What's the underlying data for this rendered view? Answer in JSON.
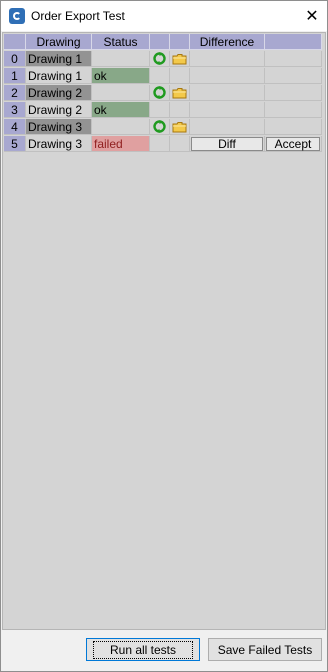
{
  "window": {
    "title": "Order Export Test"
  },
  "grid": {
    "columns": [
      "Drawing",
      "Status",
      "",
      "",
      "Difference",
      ""
    ],
    "rows": [
      {
        "index": "0",
        "drawing": "Drawing 1",
        "drawing_style": "dark",
        "status": "",
        "status_style": "empty",
        "icons": true,
        "buttons": false
      },
      {
        "index": "1",
        "drawing": "Drawing 1",
        "drawing_style": "light",
        "status": "ok",
        "status_style": "ok",
        "icons": false,
        "buttons": false
      },
      {
        "index": "2",
        "drawing": "Drawing 2",
        "drawing_style": "dark",
        "status": "",
        "status_style": "empty",
        "icons": true,
        "buttons": false
      },
      {
        "index": "3",
        "drawing": "Drawing 2",
        "drawing_style": "light",
        "status": "ok",
        "status_style": "ok",
        "icons": false,
        "buttons": false
      },
      {
        "index": "4",
        "drawing": "Drawing 3",
        "drawing_style": "dark",
        "status": "",
        "status_style": "empty",
        "icons": true,
        "buttons": false
      },
      {
        "index": "5",
        "drawing": "Drawing 3",
        "drawing_style": "light",
        "status": "failed",
        "status_style": "failed",
        "icons": false,
        "buttons": true
      }
    ],
    "diff_label": "Diff",
    "accept_label": "Accept",
    "icon_names": [
      "refresh-icon",
      "folder-icon"
    ]
  },
  "footer": {
    "run_all_label": "Run all tests",
    "save_failed_label": "Save Failed Tests"
  },
  "colors": {
    "header": "#a8a8d0",
    "ok": "#88a888",
    "failed": "#e0a0a0",
    "drawing_dark": "#939393"
  }
}
